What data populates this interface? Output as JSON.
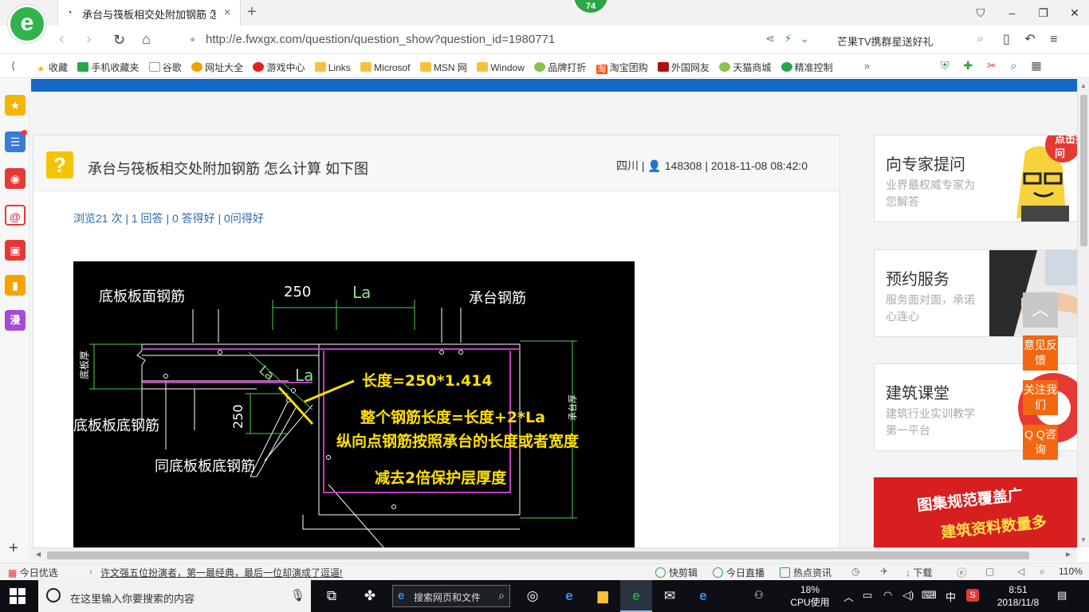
{
  "browser": {
    "logo_letter": "e",
    "badge": "74",
    "tab": {
      "title": "承台与筏板相交处附加钢筋 怎么",
      "close": "×"
    },
    "newtab": "+",
    "window_controls": [
      "⛉",
      "–",
      "❐",
      "✕"
    ]
  },
  "address": {
    "url": "http://e.fwxgx.com/question/question_show?question_id=1980771",
    "search_text": "芒果TV携群星送好礼"
  },
  "bookmarks": {
    "items": [
      {
        "label": "收藏",
        "icon": "star-icon"
      },
      {
        "label": "手机收藏夹",
        "icon": "phone-icon"
      },
      {
        "label": "谷歌",
        "icon": "page-icon"
      },
      {
        "label": "网址大全",
        "icon": "globe-icon"
      },
      {
        "label": "游戏中心",
        "icon": "game-icon"
      },
      {
        "label": "Links",
        "icon": "folder-icon"
      },
      {
        "label": "Microsof",
        "icon": "folder-icon"
      },
      {
        "label": "MSN 网",
        "icon": "folder-icon"
      },
      {
        "label": "Window",
        "icon": "folder-icon"
      },
      {
        "label": "品牌打折",
        "icon": "leaf-icon"
      },
      {
        "label": "淘宝团购",
        "icon": "taobao-icon"
      },
      {
        "label": "外国网友",
        "icon": "bookmark-icon"
      },
      {
        "label": "天猫商城",
        "icon": "leaf-icon"
      },
      {
        "label": "精准控制",
        "icon": "chat-icon"
      }
    ],
    "more": "»"
  },
  "question": {
    "title": "承台与筏板相交处附加钢筋 怎么计算 如下图",
    "location": "四川",
    "user_id": "148308",
    "datetime": "2018-11-08 08:42:0",
    "stats": "浏览21 次 | 1 回答 | 0 答得好 | 0问得好"
  },
  "drawing": {
    "label_top_left": "底板板面钢筋",
    "dim_250_top": "250",
    "dim_la_top": "La",
    "label_top_right": "承台钢筋",
    "label_thickness": "底板厚",
    "label_la_diag": "La",
    "label_la": "La",
    "label_bottom_left": "底板板底钢筋",
    "dim_250_side": "250",
    "label_same": "同底板板底钢筋",
    "label_right": "承台厚",
    "ann_1": "长度=250*1.414",
    "ann_2": "整个钢筋长度=长度+2*La",
    "ann_3": "纵向点钢筋按照承台的长度或者宽度",
    "ann_4": "减去2倍保护层厚度"
  },
  "cards": [
    {
      "title": "向专家提问",
      "sub": "业界最权威专家为您解答",
      "bubble": "点击提问"
    },
    {
      "title": "预约服务",
      "sub": "服务面对面，承诺心连心"
    },
    {
      "title": "建筑课堂",
      "sub": "建筑行业实训教学第一平台"
    }
  ],
  "banner": {
    "line1": "图集规范覆盖广",
    "line2": "建筑资料数量多"
  },
  "floating": {
    "totop": "︿",
    "feedback": "意见反馈",
    "follow": "关注我们",
    "qq": "Q Q咨询"
  },
  "status": {
    "today": "今日优选",
    "news": "许文强五位扮演者，第一最经典，最后一位却演成了逗逼!",
    "kuaijianji": "快剪辑",
    "live": "今日直播",
    "hot": "热点资讯",
    "download": "下载",
    "zoom": "110%"
  },
  "taskbar": {
    "search_placeholder": "在这里输入你要搜索的内容",
    "web_search": "搜索网页和文件",
    "cpu_pct": "18%",
    "cpu_label": "CPU使用",
    "ime": "中",
    "time": "8:51",
    "date": "2018/11/8"
  },
  "colors": {
    "accent_blue": "#1668c8",
    "brand_green": "#2aa548",
    "float_orange": "#f2670f",
    "annotation_yellow": "#ffe000",
    "rebar_magenta": "#c43bc4"
  }
}
